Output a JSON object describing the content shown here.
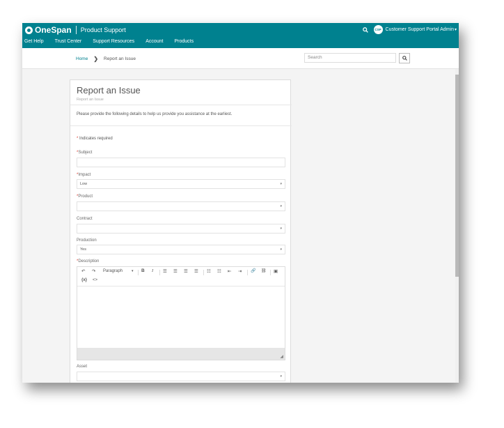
{
  "brand": {
    "name": "OneSpan",
    "product": "Product Support"
  },
  "header": {
    "user_initials": "CSP",
    "user_name": "Customer Support Portal Admin",
    "caret": "▾"
  },
  "nav": [
    "Get Help",
    "Trust Center",
    "Support Resources",
    "Account",
    "Products"
  ],
  "breadcrumb": {
    "home": "Home",
    "separator": "❯",
    "current": "Report an Issue"
  },
  "search": {
    "placeholder": "Search"
  },
  "form": {
    "title": "Report an Issue",
    "subtitle": "Report an Issue",
    "description": "Please provide the following details to help us provide you assistance at the earliest.",
    "required_note": "Indicates required",
    "required_mark": "*",
    "subject_label": "Subject",
    "impact_label": "Impact",
    "impact_value": "Low",
    "product_label": "Product",
    "product_value": "",
    "contract_label": "Contract",
    "contract_value": "",
    "production_label": "Production",
    "production_value": "Yes",
    "description_label": "Description",
    "asset_label": "Asset",
    "asset_value": "",
    "dropdown_arrow": "▾"
  },
  "editor": {
    "undo": "↶",
    "redo": "↷",
    "paragraph": "Paragraph",
    "paragraph_caret": "▾",
    "bold": "B",
    "italic": "I",
    "align_left": "☰",
    "align_center": "☰",
    "align_right": "☰",
    "align_justify": "☰",
    "bullet_list": "☷",
    "numbered_list": "☷",
    "outdent": "⇤",
    "indent": "⇥",
    "link": "🔗",
    "unlink": "⛓",
    "image": "▣",
    "variable": "{x}",
    "code": "<>",
    "resize": "◢"
  },
  "colors": {
    "brand": "#00818f",
    "required": "#d9352b"
  }
}
